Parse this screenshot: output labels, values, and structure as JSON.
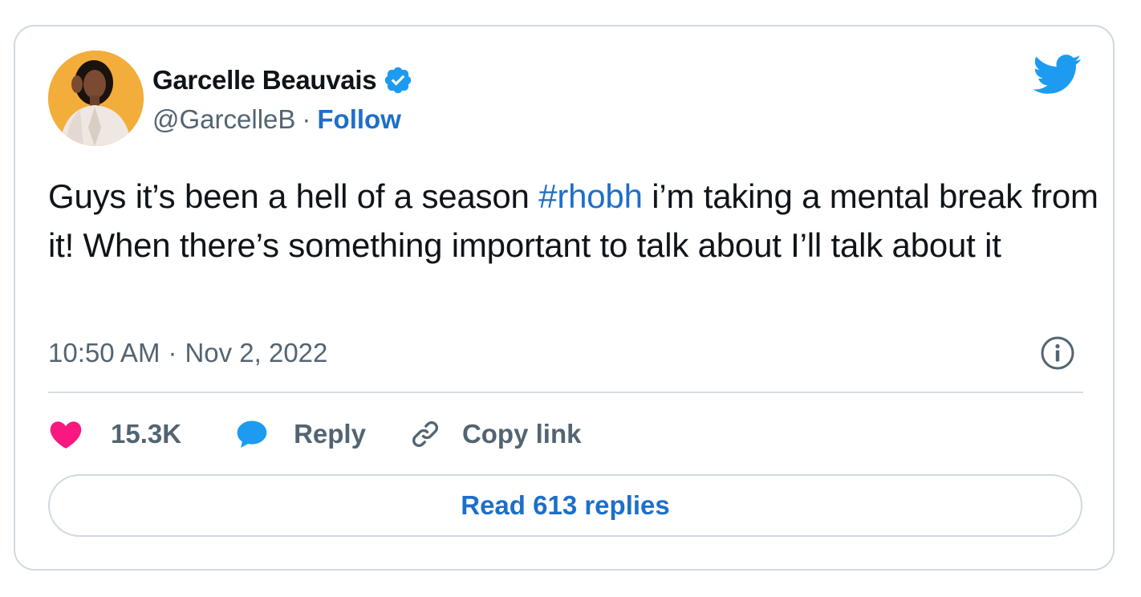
{
  "author": {
    "name": "Garcelle Beauvais",
    "handle": "@GarcelleB",
    "separator": "·",
    "follow_label": "Follow"
  },
  "tweet": {
    "text_before": "Guys it’s been a hell of a season ",
    "hashtag": "#rhobh",
    "text_after": " i’m taking a mental break from it! When there’s something important to talk about I’ll talk about it",
    "time": "10:50 AM",
    "date_separator": "·",
    "date": "Nov 2, 2022"
  },
  "actions": {
    "likes": "15.3K",
    "reply_label": "Reply",
    "copy_link_label": "Copy link"
  },
  "read_replies_label": "Read 613 replies",
  "icons": {
    "avatar": "avatar",
    "verified": "verified-badge-icon",
    "twitter": "twitter-bird-icon",
    "info": "info-icon",
    "heart": "heart-icon",
    "reply": "reply-bubble-icon",
    "link": "link-icon"
  },
  "colors": {
    "link_blue": "#1d6fc9",
    "twitter_blue": "#1d9bf0",
    "heart_pink": "#f91880",
    "muted_text": "#536471",
    "border": "#cfd9de",
    "avatar_bg": "#f3ad3a"
  }
}
